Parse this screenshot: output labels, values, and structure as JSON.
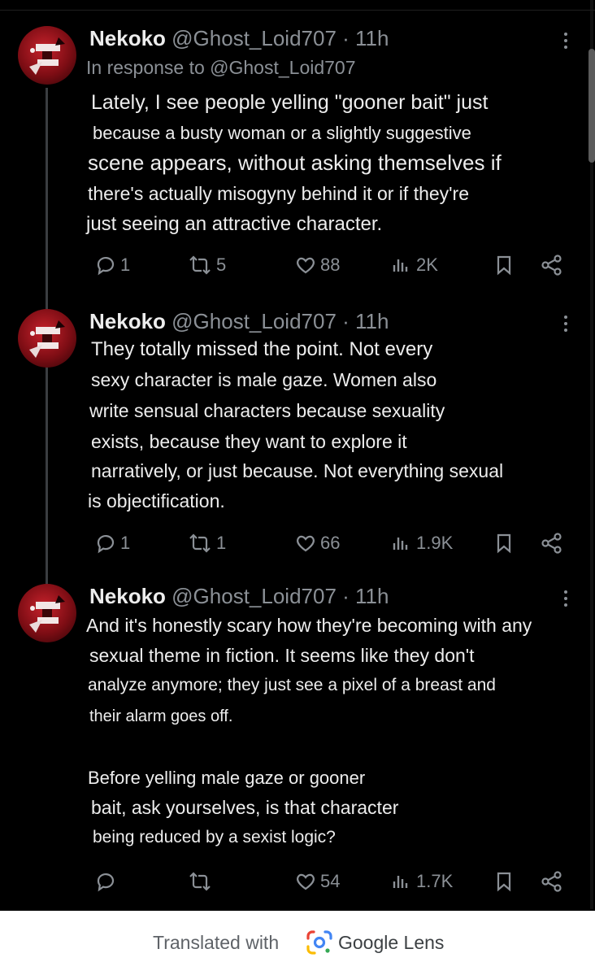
{
  "tweets": [
    {
      "name": "Nekoko",
      "handle": "@Ghost_Loid707",
      "time": "11h",
      "reply_context": "In response to @Ghost_Loid707",
      "lines": [
        "Lately, I see people yelling \"gooner bait\" just",
        "because a busty woman or a slightly suggestive",
        "scene appears, without asking themselves if",
        "there's actually misogyny behind it or if they're",
        "just seeing an attractive character."
      ],
      "replies": "1",
      "reposts": "5",
      "likes": "88",
      "views": "2K"
    },
    {
      "name": "Nekoko",
      "handle": "@Ghost_Loid707",
      "time": "11h",
      "lines": [
        "They totally missed the point. Not every",
        "sexy character is male gaze. Women also",
        "write sensual characters because sexuality",
        "exists, because they want to explore it",
        "narratively, or just because. Not everything sexual",
        "is objectification."
      ],
      "replies": "1",
      "reposts": "1",
      "likes": "66",
      "views": "1.9K"
    },
    {
      "name": "Nekoko",
      "handle": "@Ghost_Loid707",
      "time": "11h",
      "lines": [
        "And it's honestly scary how they're becoming with any",
        "sexual theme in fiction. It seems like they don't",
        "analyze anymore; they just see a pixel of a breast and",
        "their alarm goes off.",
        "Before yelling male gaze or gooner",
        "bait, ask yourselves, is that character",
        "being reduced by a sexist logic?"
      ],
      "replies": "",
      "reposts": "",
      "likes": "54",
      "views": "1.7K"
    }
  ],
  "footer": {
    "translated_with": "Translated with",
    "brand": "Google Lens"
  },
  "icons": {
    "reply": "reply-icon",
    "repost": "repost-icon",
    "like": "like-icon",
    "views": "views-icon",
    "bookmark": "bookmark-icon",
    "share": "share-icon",
    "more": "more-vertical-icon",
    "lens": "google-lens-logo"
  },
  "colors": {
    "background": "#000000",
    "text": "#ededed",
    "muted": "#8b9096",
    "footer_bg": "#ffffff"
  }
}
